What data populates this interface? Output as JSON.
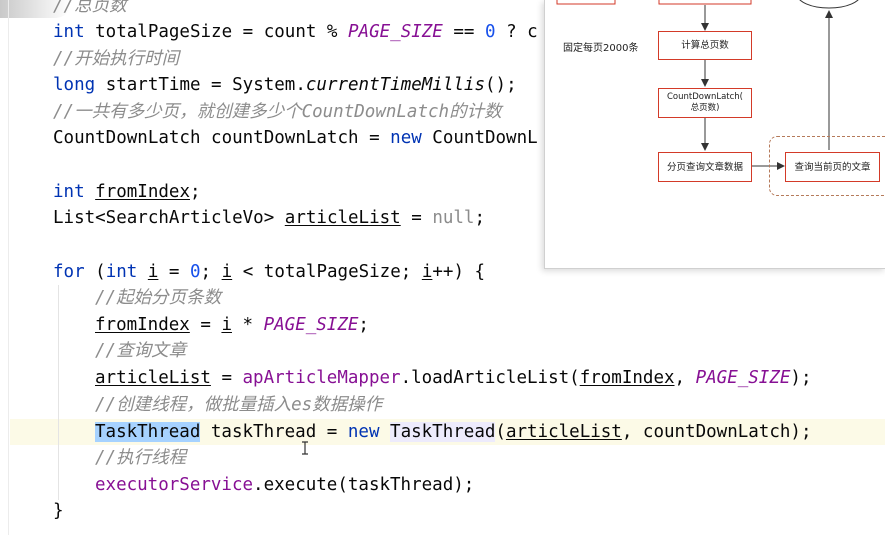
{
  "code": {
    "l0_comment": "//总页数",
    "l1_int": "int",
    "l1_a": " totalPageSize = count % ",
    "l1_const": "PAGE_SIZE",
    "l1_b": " == ",
    "l1_num": "0",
    "l1_c": " ? c",
    "l2_comment": "//开始执行时间",
    "l3_long": "long",
    "l3_a": " startTime = System.",
    "l3_static": "currentTimeMillis",
    "l3_b": "();",
    "l4_comment": "//一共有多少页，就创建多少个CountDownLatch的计数",
    "l5_a": "CountDownLatch countDownLatch = ",
    "l5_new": "new",
    "l5_b": " CountDownL",
    "l6_int": "int",
    "l6_sp": " ",
    "l6_var": "fromIndex",
    "l6_end": ";",
    "l7_type": "List<SearchArticleVo> ",
    "l7_var": "articleList",
    "l7_eq": " = ",
    "l7_null": "null",
    "l7_end": ";",
    "l8_for": "for",
    "l8_a": " (",
    "l8_int": "int",
    "l8_sp": " ",
    "l8_i1": "i",
    "l8_b": " = ",
    "l8_zero": "0",
    "l8_c": "; ",
    "l8_i2": "i",
    "l8_d": " < totalPageSize; ",
    "l8_i3": "i",
    "l8_e": "++) {",
    "l9_comment": "//起始分页条数",
    "l10_var": "fromIndex",
    "l10_a": " = ",
    "l10_i": "i",
    "l10_b": " * ",
    "l10_const": "PAGE_SIZE",
    "l10_end": ";",
    "l11_comment": "//查询文章",
    "l12_var": "articleList",
    "l12_a": " = ",
    "l12_mapper": "apArticleMapper",
    "l12_b": ".loadArticleList(",
    "l12_arg": "fromIndex",
    "l12_c": ", ",
    "l12_const": "PAGE_SIZE",
    "l12_end": ");",
    "l13_comment": "//创建线程，做批量插入es数据操作",
    "l14_sel": "TaskThread",
    "l14_a": " taskThread = ",
    "l14_new": "new",
    "l14_sp": " ",
    "l14_cls": "TaskThread",
    "l14_b": "(",
    "l14_arg": "articleList",
    "l14_c": ", countDownLatch);",
    "l15_comment": "//执行线程",
    "l16_exec": "executorService",
    "l16_a": ".execute(taskThread);",
    "l17_brace": "}"
  },
  "diagram": {
    "label_fixed": "固定每页2000条",
    "node_calc": "计算总页数",
    "node_latch": "CountDownLatch(\n总页数)",
    "node_page": "分页查询文章数据",
    "node_query": "查询当前页的文章"
  },
  "colors": {
    "keyword": "#0033b3",
    "comment": "#8c8c8c",
    "constant": "#871094",
    "number": "#1750eb",
    "diagram_border": "#d33a28",
    "selection": "#a6d2ff"
  }
}
